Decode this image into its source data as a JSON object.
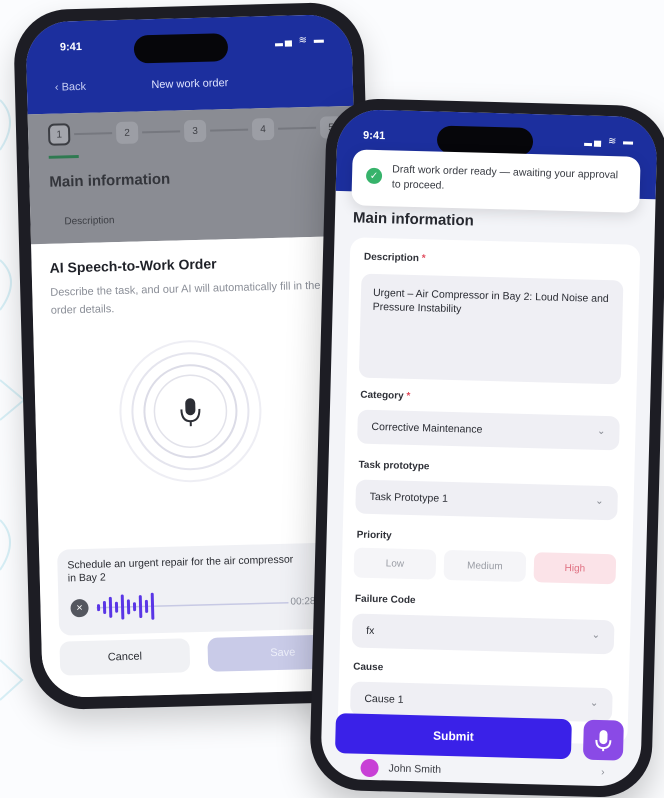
{
  "back_phone": {
    "status": {
      "time": "9:41",
      "icons": "▂▄ ≋ ▬"
    },
    "header": {
      "back_label": "‹ Back",
      "title": "New work order"
    },
    "steps": [
      "1",
      "2",
      "3",
      "4",
      "5"
    ],
    "main_title": "Main information",
    "description_label": "Description",
    "sheet": {
      "title": "AI Speech-to-Work Order",
      "subtitle": "Describe the task, and our AI will automatically fill in the work order details.",
      "transcript": "Schedule an urgent repair for the air compressor in Bay 2",
      "duration": "00:28",
      "close_icon": "×",
      "cancel_label": "Cancel",
      "save_label": "Save"
    }
  },
  "front_phone": {
    "status": {
      "time": "9:41",
      "icons": "▂▄ ≋ ▬"
    },
    "toast": {
      "check": "✓",
      "text": "Draft work order ready — awaiting your approval to proceed."
    },
    "main_title": "Main information",
    "description": {
      "label": "Description",
      "required": "*",
      "value": "Urgent – Air Compressor in Bay 2: Loud Noise and Pressure Instability"
    },
    "category": {
      "label": "Category",
      "required": "*",
      "value": "Corrective Maintenance"
    },
    "task_prototype": {
      "label": "Task prototype",
      "value": "Task Prototype 1"
    },
    "priority": {
      "label": "Priority",
      "options": [
        "Low",
        "Medium",
        "High"
      ],
      "selected": "High"
    },
    "failure_code": {
      "label": "Failure Code",
      "value": "fx"
    },
    "cause": {
      "label": "Cause",
      "value": "Cause 1"
    },
    "chevron": "⌄",
    "submit_label": "Submit",
    "assignee": {
      "name": "John Smith",
      "chevron": "›"
    }
  },
  "colors": {
    "header_blue": "#1c2f9e",
    "submit_purple": "#3a21e8",
    "mic_purple": "#8a4ae6",
    "success_green": "#37b36b",
    "priority_high": "#e07081"
  }
}
